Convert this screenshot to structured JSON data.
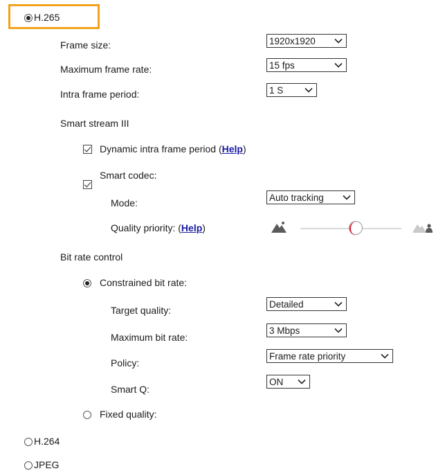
{
  "codecs": {
    "h265": {
      "label": "H.265",
      "selected": true
    },
    "h264": {
      "label": "H.264",
      "selected": false
    },
    "jpeg": {
      "label": "JPEG",
      "selected": false
    }
  },
  "h265_settings": {
    "frame_size": {
      "label": "Frame size:",
      "value": "1920x1920"
    },
    "max_frame_rate": {
      "label": "Maximum frame rate:",
      "value": "15 fps"
    },
    "intra_frame_period": {
      "label": "Intra frame period:",
      "value": "1 S"
    },
    "smart_stream": {
      "title": "Smart stream III",
      "dynamic_intra": {
        "label": "Dynamic intra frame period (",
        "help": "Help",
        "suffix": ")",
        "checked": true
      },
      "smart_codec": {
        "label": "Smart codec:",
        "checked": true
      },
      "mode": {
        "label": "Mode:",
        "value": "Auto tracking"
      },
      "quality_priority": {
        "label": "Quality priority: (",
        "help": "Help",
        "suffix": ")",
        "slider_fraction": 0.55
      }
    },
    "bit_rate_control": {
      "title": "Bit rate control",
      "constrained": {
        "label": "Constrained bit rate:",
        "selected": true,
        "target_quality": {
          "label": "Target quality:",
          "value": "Detailed"
        },
        "max_bit_rate": {
          "label": "Maximum bit rate:",
          "value": "3 Mbps"
        },
        "policy": {
          "label": "Policy:",
          "value": "Frame rate priority"
        },
        "smart_q": {
          "label": "Smart Q:",
          "value": "ON"
        }
      },
      "fixed_quality": {
        "label": "Fixed quality:",
        "selected": false
      }
    }
  },
  "colors": {
    "highlight": "#f3a31a",
    "link": "#1a1aa6",
    "knob_accent": "#e0202a"
  },
  "icons": {
    "slider_left": "landscape-icon",
    "slider_right": "landscape-person-icon"
  }
}
